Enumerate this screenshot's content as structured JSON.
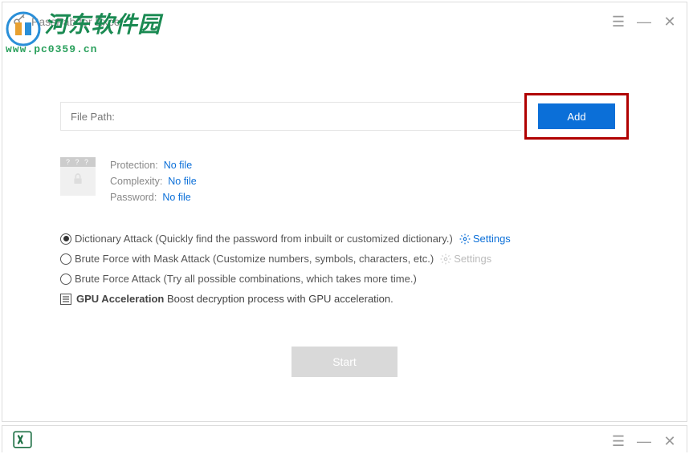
{
  "app": {
    "title": "PassFab for Excel"
  },
  "watermark": {
    "text": "河东软件园",
    "url": "www.pc0359.cn"
  },
  "filePath": {
    "label": "File Path:",
    "value": ""
  },
  "addBtn": "Add",
  "info": {
    "qmarks": "? ? ?",
    "protection": {
      "label": "Protection:",
      "value": "No file"
    },
    "complexity": {
      "label": "Complexity:",
      "value": "No file"
    },
    "password": {
      "label": "Password:",
      "value": "No file"
    }
  },
  "options": {
    "dict": "Dictionary Attack (Quickly find the password from inbuilt or customized dictionary.)",
    "mask": "Brute Force with Mask Attack (Customize numbers, symbols, characters, etc.)",
    "brute": "Brute Force Attack (Try all possible combinations, which takes more time.)",
    "settings": "Settings"
  },
  "gpu": {
    "strong": "GPU Acceleration",
    "rest": " Boost decryption process with GPU acceleration."
  },
  "startBtn": "Start"
}
